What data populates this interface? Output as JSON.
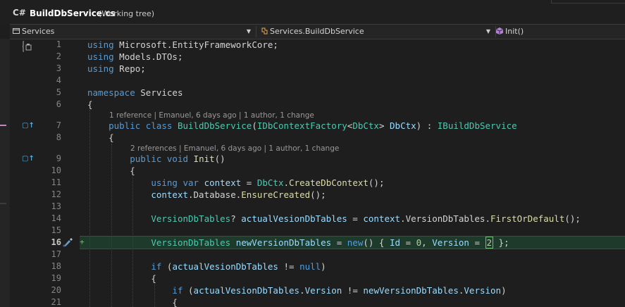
{
  "title": {
    "lang_badge": "C#",
    "file_name": "BuildDbService.cs",
    "status": "(Working tree)"
  },
  "navbar": {
    "project": "Services",
    "type": "Services.BuildDbService",
    "member": "Init()"
  },
  "codelens": {
    "class": "1 reference | Emanuel, 6 days ago | 1 author, 1 change",
    "method": "2 references | Emanuel, 6 days ago | 1 author, 1 change"
  },
  "line_numbers": [
    "1",
    "2",
    "3",
    "4",
    "5",
    "6",
    "7",
    "8",
    "9",
    "10",
    "11",
    "12",
    "13",
    "14",
    "15",
    "16",
    "17",
    "18",
    "19",
    "20",
    "21"
  ],
  "current_line": "16",
  "change_marker": "+",
  "code": {
    "l1": "Microsoft.EntityFrameworkCore;",
    "l2": "Models.DTOs;",
    "l3": "Repo;",
    "l5_ns": "Services",
    "l7_class": "BuildDbService",
    "l7_factory": "IDbContextFactory",
    "l7_ctx": "DbCtx",
    "l7_ctx2": "DbCtx",
    "l7_iface": "IBuildDbService",
    "l9_method": "Init",
    "l11_var": "context",
    "l11_type": "DbCtx",
    "l11_call": "CreateDbContext",
    "l12_obj": "context",
    "l12_prop": "Database",
    "l12_call": "EnsureCreated",
    "l14_type": "VersionDbTables",
    "l14_var": "actualVesionDbTables",
    "l14_obj": "context",
    "l14_prop": "VersionDbTables",
    "l14_call": "FirstOrDefault",
    "l16_type": "VersionDbTables",
    "l16_var": "newVersionDbTables",
    "l16_id": "Id",
    "l16_id_val": "0",
    "l16_ver": "Version",
    "l16_ver_val": "2",
    "l18_var": "actualVesionDbTables",
    "l20_var": "actualVesionDbTables",
    "l20_prop": "Version",
    "l20_var2": "newVersionDbTables",
    "l20_prop2": "Version"
  }
}
